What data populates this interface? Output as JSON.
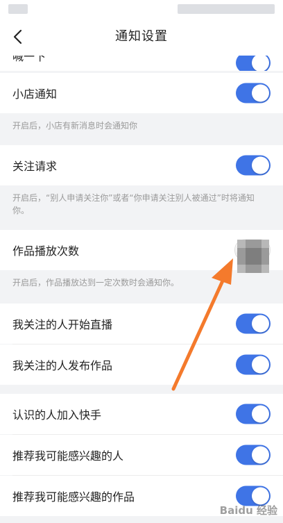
{
  "header": {
    "title": "通知设置"
  },
  "rows": [
    {
      "label": "小店通知",
      "on": true
    },
    {
      "label": "关注请求",
      "on": true
    },
    {
      "label": "作品播放次数",
      "on": false
    },
    {
      "label": "我关注的人开始直播",
      "on": true
    },
    {
      "label": "我关注的人发布作品",
      "on": true
    },
    {
      "label": "认识的人加入快手",
      "on": true
    },
    {
      "label": "推荐我可能感兴趣的人",
      "on": true
    },
    {
      "label": "推荐我可能感兴趣的作品",
      "on": true
    }
  ],
  "hints": {
    "shop": "开启后，小店有新消息时会通知你",
    "follow": "开启后，“别人申请关注你”或者“你申请关注别人被通过”时将通知你。",
    "plays": "开启后，作品播放达到一定次数时会通知你。"
  },
  "partial_row_label": "喊一下",
  "colors": {
    "accent": "#3f74e6",
    "arrow": "#f47a2c"
  },
  "watermark": "Baidu 经验"
}
